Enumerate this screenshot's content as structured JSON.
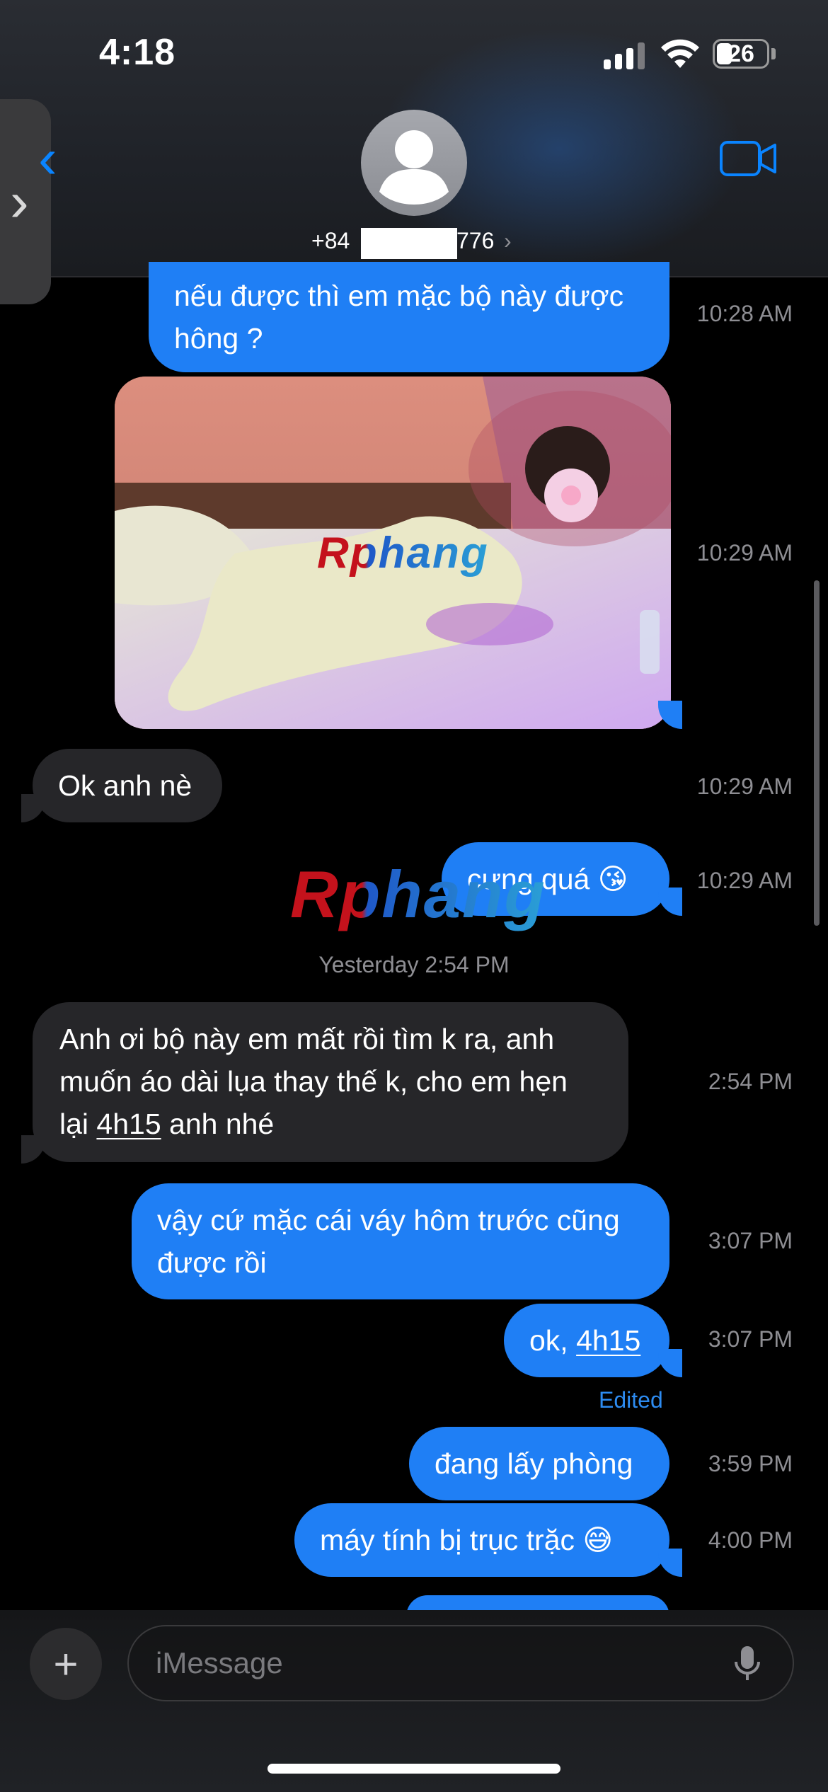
{
  "status_bar": {
    "time": "4:18",
    "battery": "26"
  },
  "header": {
    "contact_prefix": "+84",
    "contact_suffix": "776"
  },
  "messages": [
    {
      "type": "sent",
      "text": "nếu được thì em mặc bộ này được hông ?",
      "time": "10:28 AM"
    },
    {
      "type": "sent-photo",
      "time": "10:29 AM"
    },
    {
      "type": "received",
      "text": "Ok anh nè",
      "time": "10:29 AM"
    },
    {
      "type": "sent",
      "text": "cưng quá 😘",
      "time": "10:29 AM"
    },
    {
      "type": "received",
      "text_part1": "Anh ơi bộ này em mất rồi tìm k ra, anh muốn áo dài lụa thay thế k, cho em hẹn lại ",
      "link": "4h15",
      "text_part2": " anh nhé",
      "time": "2:54 PM"
    },
    {
      "type": "sent",
      "text": "vậy cứ mặc cái váy hôm trước cũng được rồi",
      "time": "3:07 PM"
    },
    {
      "type": "sent",
      "text_part1": "ok, ",
      "link": "4h15",
      "time": "3:07 PM",
      "status": "Edited"
    },
    {
      "type": "sent",
      "text": "đang lấy phòng",
      "time": "3:59 PM"
    },
    {
      "type": "sent",
      "text": "máy tính bị trục trặc 😅",
      "time": "4:00 PM"
    }
  ],
  "day_separator": {
    "day": "Yesterday",
    "time": "2:54 PM"
  },
  "watermark": "Rphang",
  "composer": {
    "placeholder": "iMessage"
  },
  "colors": {
    "sent_bubble": "#1f7ff5",
    "received_bubble": "#262629",
    "accent": "#0a84ff"
  }
}
